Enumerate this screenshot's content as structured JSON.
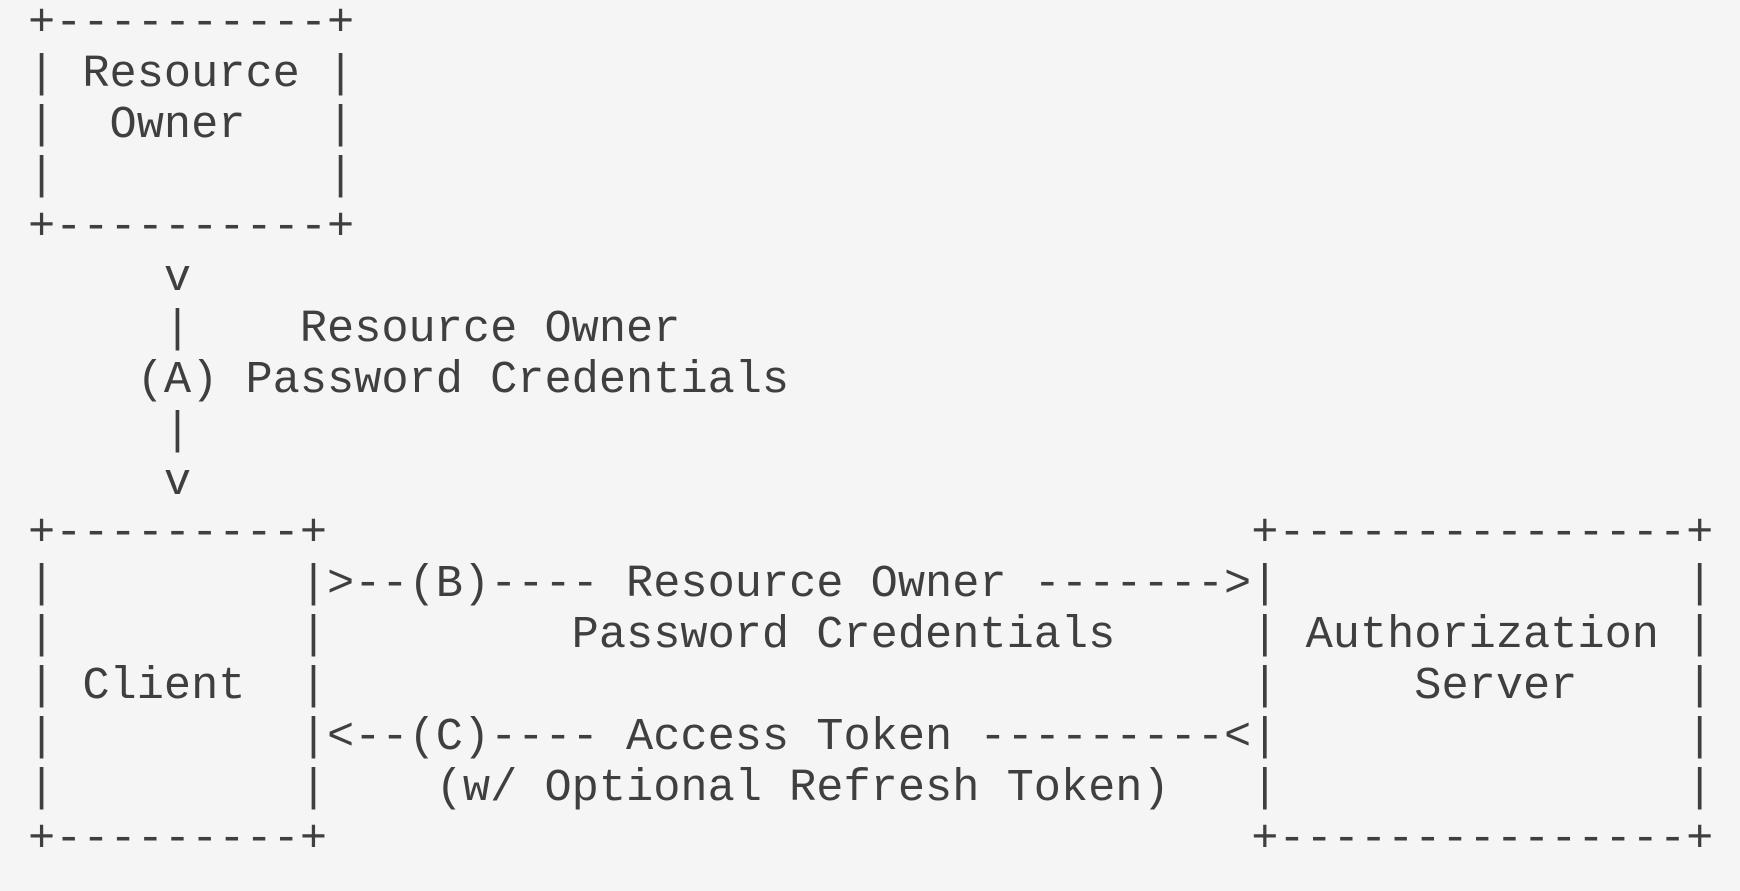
{
  "diagram": {
    "lines": [
      "+----------+",
      "| Resource |",
      "|  Owner   |",
      "|          |",
      "+----------+",
      "     v",
      "     |    Resource Owner",
      "    (A) Password Credentials",
      "     |",
      "     v",
      "+---------+                                  +---------------+",
      "|         |>--(B)---- Resource Owner ------->|               |",
      "|         |         Password Credentials     | Authorization |",
      "| Client  |                                  |     Server    |",
      "|         |<--(C)---- Access Token ---------<|               |",
      "|         |    (w/ Optional Refresh Token)   |               |",
      "+---------+                                  +---------------+"
    ]
  }
}
